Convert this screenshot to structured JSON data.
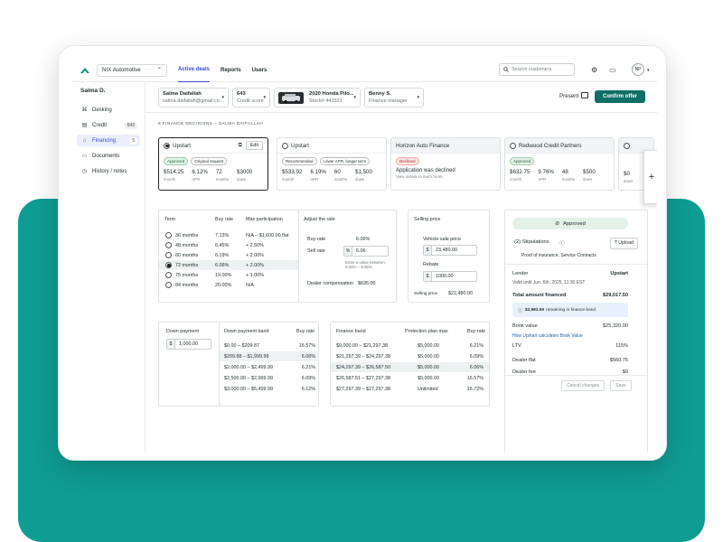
{
  "nav": {
    "dealer": "NIX Automotive",
    "tabs": [
      "Active deals",
      "Reports",
      "Users"
    ],
    "search_placeholder": "Search customers",
    "avatar": "NP"
  },
  "sidebar": {
    "customer": "Salma D.",
    "items": [
      {
        "label": "Desking",
        "icon": "desk-icon"
      },
      {
        "label": "Credit",
        "icon": "card-icon",
        "badge": "643"
      },
      {
        "label": "Financing",
        "icon": "bank-icon",
        "badge": "5",
        "active": true
      },
      {
        "label": "Documents",
        "icon": "folder-icon"
      },
      {
        "label": "History / notes",
        "icon": "history-icon"
      }
    ]
  },
  "deal": {
    "customer_name": "Salma Daifallah",
    "customer_email": "salma.daifallah@gmail.co...",
    "credit_score": "643",
    "credit_label": "Credit score",
    "vehicle": "2020 Honda Pilo...",
    "stock": "Stock# 443321",
    "manager": "Benny S.",
    "manager_label": "Finance manager",
    "present": "Present",
    "confirm": "Confirm offer"
  },
  "decisions_heading": "5 FINANCE DECISIONS – SALMA DAIFALLAH",
  "cards": [
    {
      "name": "Upstart",
      "edit": "Edit",
      "chips": [
        "Approved",
        "Original request"
      ],
      "metrics": [
        [
          "$514.25",
          "/month"
        ],
        [
          "6.12%",
          "APR"
        ],
        [
          "72",
          "months"
        ],
        [
          "$3000",
          "down"
        ]
      ]
    },
    {
      "name": "Upstart",
      "chips": [
        "Recommended",
        "Lower APR, longer term"
      ],
      "metrics": [
        [
          "$533.92",
          "/month"
        ],
        [
          "6.19%",
          "APR"
        ],
        [
          "60",
          "months"
        ],
        [
          "$1,500",
          "down"
        ]
      ]
    },
    {
      "name": "Horizon Auto Finance",
      "chips": [
        "Declined"
      ],
      "declined_msg": "Application was declined",
      "declined_sub": "View details to learn more"
    },
    {
      "name": "Redwood Credit Partners",
      "chips": [
        "Approved"
      ],
      "metrics": [
        [
          "$632.75",
          "/month"
        ],
        [
          "9.76%",
          "APR"
        ],
        [
          "48",
          "months"
        ],
        [
          "$500",
          "down"
        ]
      ]
    }
  ],
  "card5_metrics": [
    [
      "$0",
      "down"
    ]
  ],
  "term_table": {
    "headers": [
      "Term",
      "Buy rate",
      "Max participation"
    ],
    "rows": [
      [
        "36 months",
        "7.13%",
        "N/A – $1,600.00 flat"
      ],
      [
        "48 months",
        "6.45%",
        "+ 2.50%"
      ],
      [
        "60 months",
        "6.19%",
        "+ 2.00%"
      ],
      [
        "72 months",
        "6.06%",
        "+ 2.00%"
      ],
      [
        "75 months",
        "19.00%",
        "+ 1.00%"
      ],
      [
        "84 months",
        "20.00%",
        "N/A"
      ]
    ],
    "selected": 3
  },
  "adjust": {
    "title": "Adjust the rate",
    "buy_rate_label": "Buy rate",
    "buy_rate": "6.06%",
    "sell_rate_label": "Sell rate",
    "sell_rate": "6.06",
    "hint1": "Enter a value between",
    "hint2": "6.06% – 8.06%",
    "comp_label": "Dealer compensation",
    "comp": "$635.00"
  },
  "selling": {
    "title": "Selling price",
    "vsp_label": "Vehicle sale price",
    "vsp": "23,480.00",
    "rebate_label": "Rebate",
    "rebate": "1000.00",
    "sp_label": "Selling price",
    "sp": "$22,480.00"
  },
  "down": {
    "title": "Down payment",
    "value": "1,000.00",
    "headers": [
      "Down payment band",
      "Buy rate"
    ],
    "rows": [
      [
        "$0.00 – $209.87",
        "16.57%"
      ],
      [
        "$209.88 – $1,999.99",
        "6.06%"
      ],
      [
        "$2,000.00 – $2,499.99",
        "6.21%"
      ],
      [
        "$2,500.00 – $2,999.99",
        "6.09%"
      ],
      [
        "$3,000.00 – $5,499.99",
        "6.12%"
      ]
    ],
    "selected": 1
  },
  "finance_band": {
    "headers": [
      "Finance band",
      "Protection plan max",
      "Buy rate"
    ],
    "rows": [
      [
        "$9,000.00 – $21,297.38",
        "$5,000.00",
        "6.21%"
      ],
      [
        "$21,297.39 – $24,297.38",
        "$5,000.00",
        "6.09%"
      ],
      [
        "$24,297.39 – $26,587.50",
        "$5,000.00",
        "6.06%"
      ],
      [
        "$26,587.51 – $27,297.38",
        "$5,000.00",
        "16.57%"
      ],
      [
        "$27,297.39 – $27,297.38",
        "Unlimited",
        "16.72%"
      ]
    ],
    "selected": 2
  },
  "summary": {
    "status": "Approved",
    "stip_title": "(2) Stipulations",
    "upload": "Upload",
    "stip_desc": "Proof of insurance, Service Contracts",
    "lender_label": "Lender",
    "lender": "Upstart",
    "valid": "Valid until Jun. 6th, 2025, 11:30 EST",
    "total_label": "Total amount financed",
    "total": "$29,017.50",
    "remaining_amt": "$2,982.50",
    "remaining_txt": "remaining in finance band",
    "book_label": "Book value",
    "book": "$25,320.00",
    "book_link": "How Upstart calculates Book Value",
    "ltv_label": "LTV",
    "ltv": "115%",
    "flat_label": "Dealer flat",
    "flat": "$560.75",
    "fee_label": "Dealer fee",
    "fee": "$0",
    "cancel": "Cancel changes",
    "save": "Save"
  },
  "colors": {
    "accent": "#3a4bd6",
    "brand_green": "#0f6e66",
    "teal_bg": "#0f9c93"
  }
}
